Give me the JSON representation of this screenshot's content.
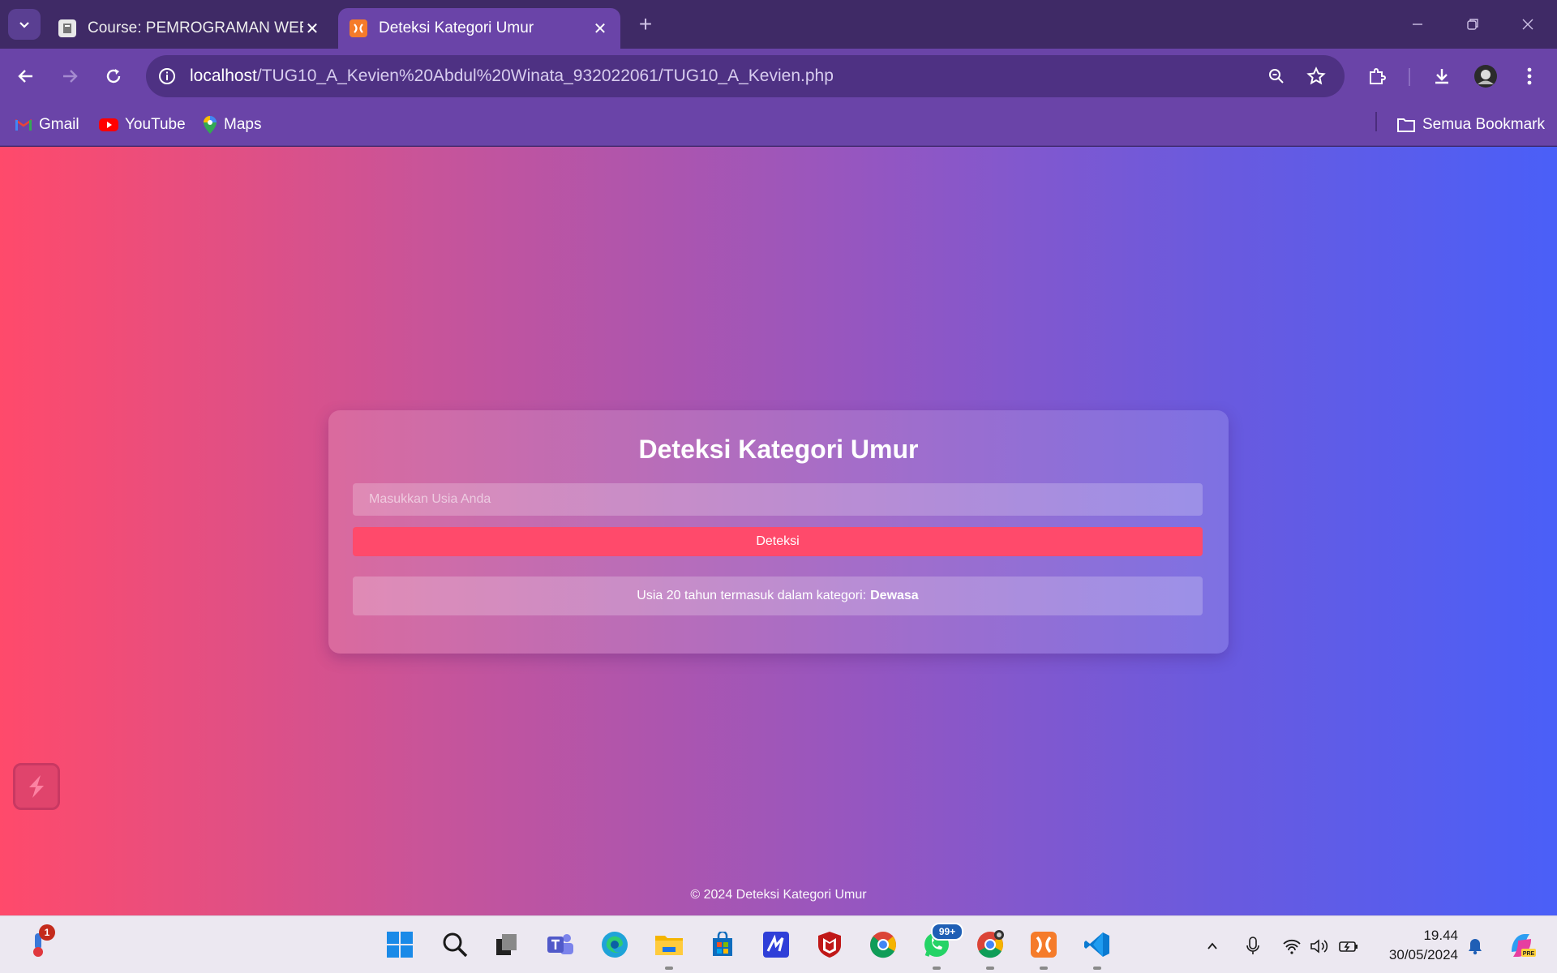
{
  "browser": {
    "tabs": [
      {
        "title": "Course: PEMROGRAMAN WEB",
        "active": false
      },
      {
        "title": "Deteksi Kategori Umur",
        "active": true
      }
    ],
    "address": {
      "host": "localhost",
      "path": "/TUG10_A_Kevien%20Abdul%20Winata_932022061/TUG10_A_Kevien.php"
    },
    "bookmarks": [
      "Gmail",
      "YouTube",
      "Maps"
    ],
    "all_bookmarks_label": "Semua Bookmark"
  },
  "page": {
    "heading": "Deteksi Kategori Umur",
    "age_input": {
      "placeholder": "Masukkan Usia Anda",
      "value": ""
    },
    "detect_button": "Deteksi",
    "result_prefix": "Usia 20 tahun termasuk dalam kategori:",
    "result_category": "Dewasa",
    "footer": "© 2024 Deteksi Kategori Umur"
  },
  "taskbar": {
    "weather_badge": "1",
    "whatsapp_badge": "99+",
    "clock": {
      "time": "19.44",
      "date": "30/05/2024"
    }
  },
  "colors": {
    "chrome": "#6a44a8",
    "tabstrip": "#3f2a66",
    "accent_button": "#ff4a6b",
    "gradient_left": "#ff4a6b",
    "gradient_right": "#4a5ff8"
  }
}
